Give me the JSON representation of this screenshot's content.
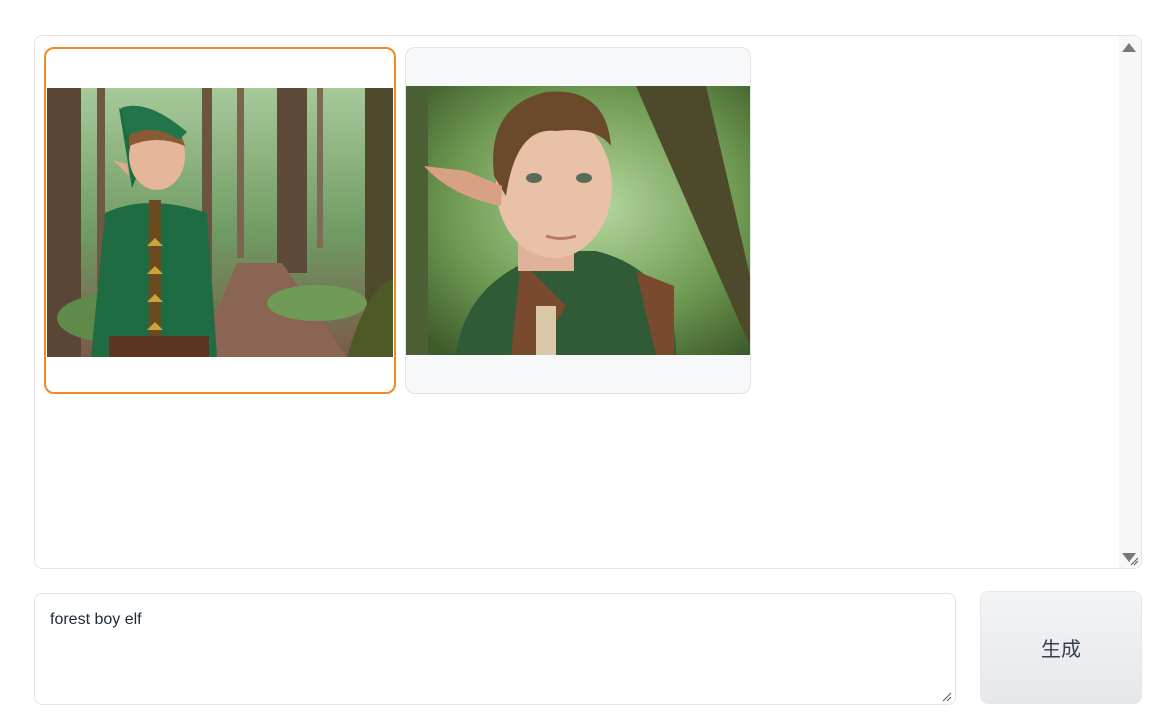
{
  "gallery": {
    "images": [
      {
        "icon": "forest-elf-boy-full-body-image",
        "selected": true
      },
      {
        "icon": "forest-elf-boy-portrait-image",
        "selected": false
      }
    ]
  },
  "prompt": {
    "value": "forest boy elf"
  },
  "generate": {
    "label": "生成"
  },
  "colors": {
    "selected_border": "#f08a24",
    "button_bg": "#e5e7eb"
  }
}
